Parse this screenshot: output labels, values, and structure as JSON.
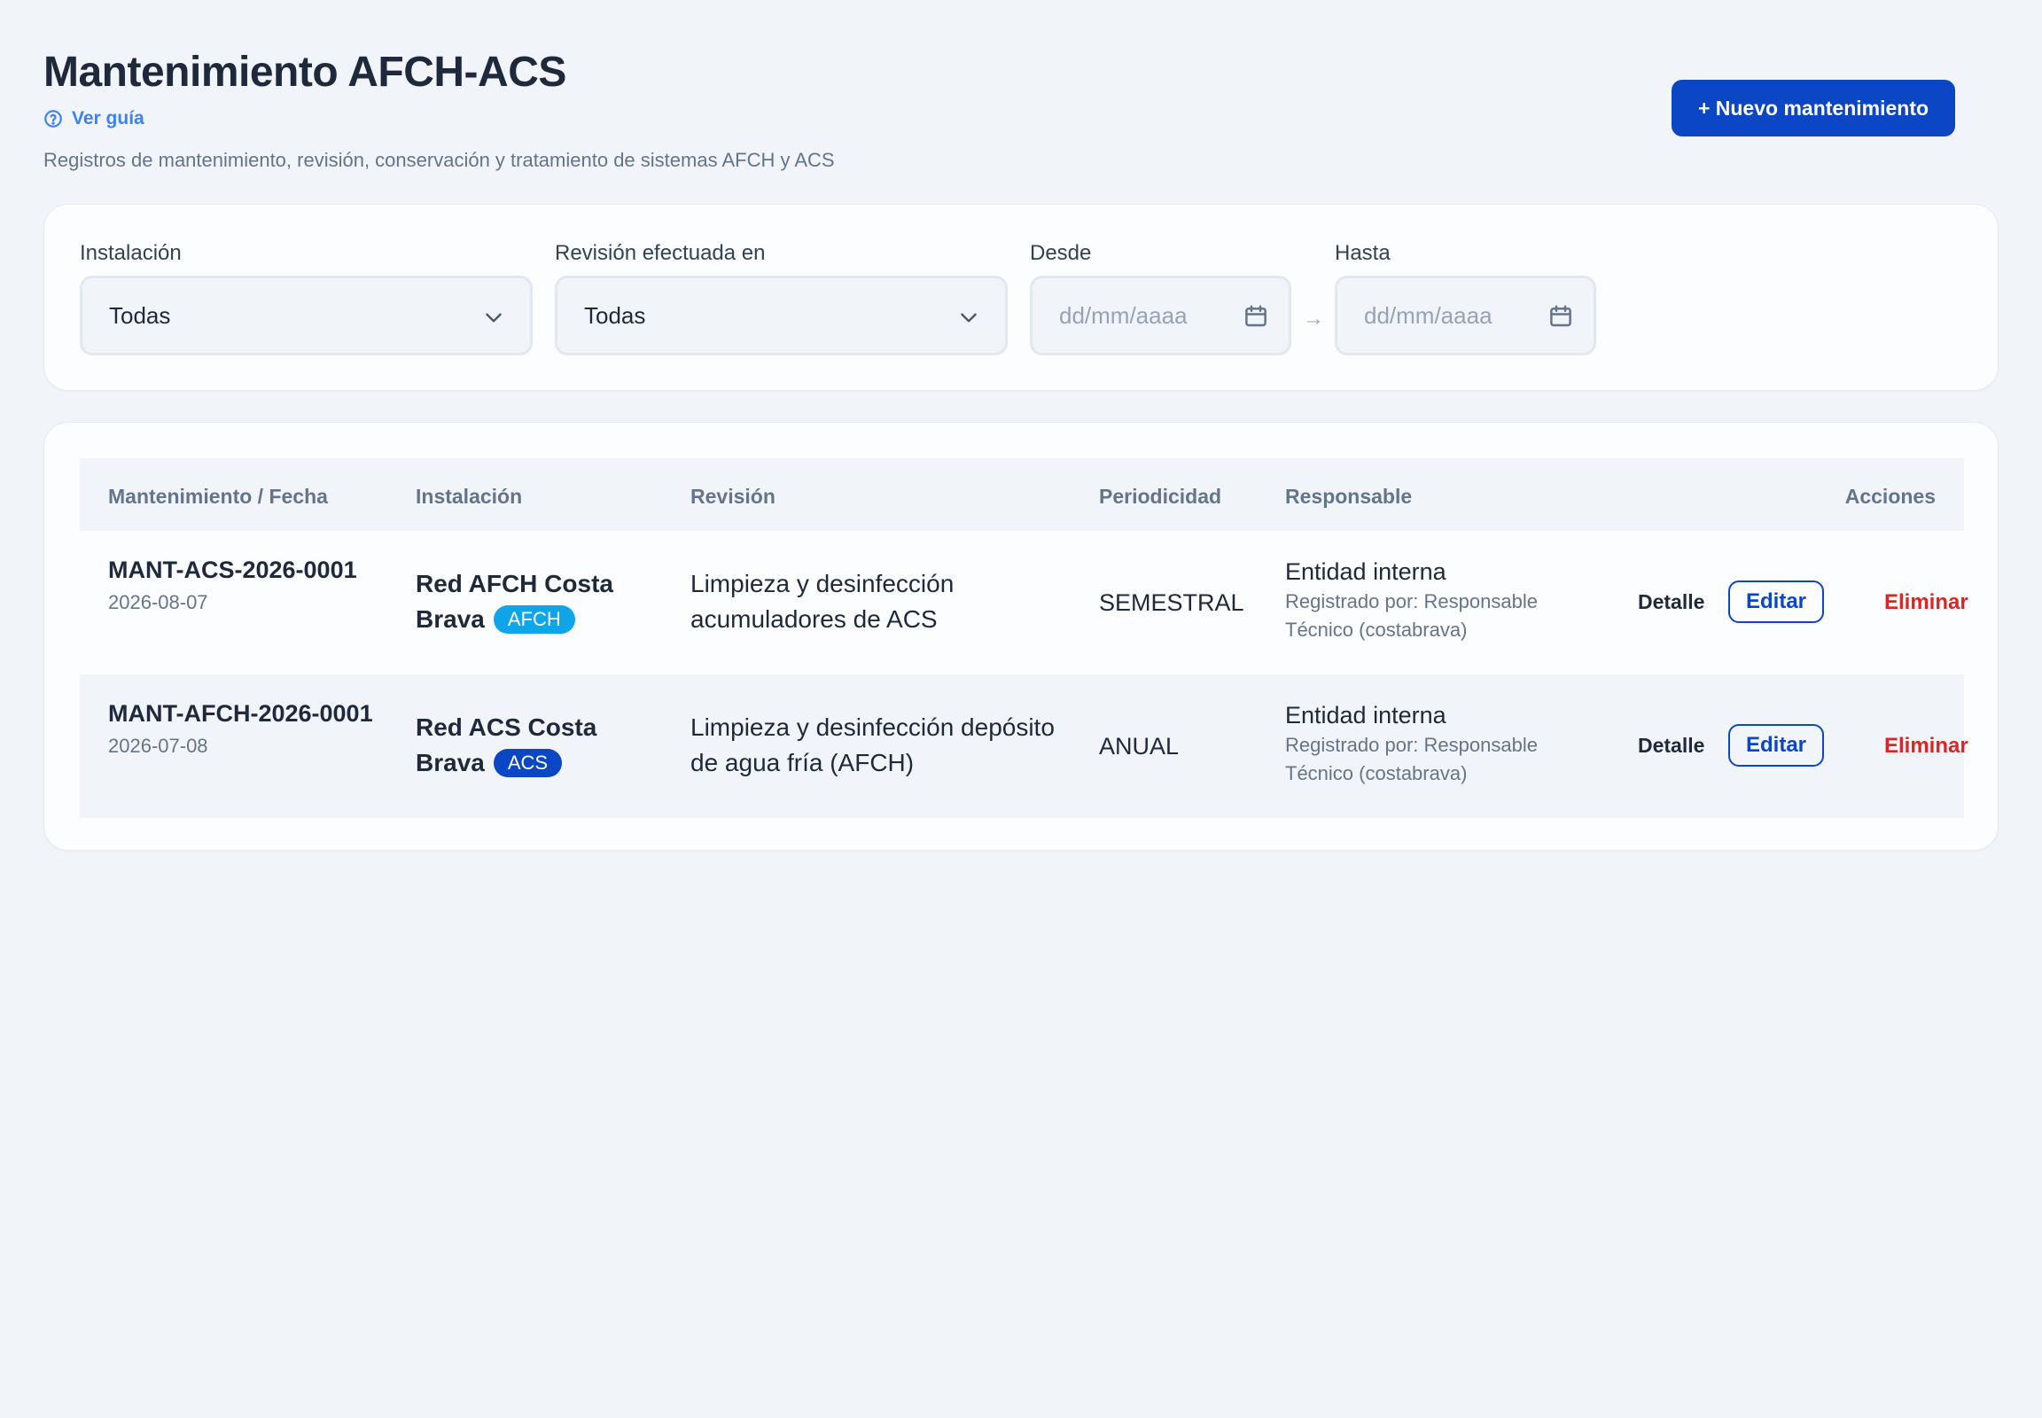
{
  "header": {
    "title": "Mantenimiento AFCH-ACS",
    "guide_label": "Ver guía",
    "subtitle": "Registros de mantenimiento, revisión, conservación y tratamiento de sistemas AFCH y ACS",
    "new_button_label": "+ Nuevo mantenimiento"
  },
  "filters": {
    "installation": {
      "label": "Instalación",
      "value": "Todas"
    },
    "revision_in": {
      "label": "Revisión efectuada en",
      "value": "Todas"
    },
    "from": {
      "label": "Desde",
      "placeholder": "dd/mm/aaaa"
    },
    "to": {
      "label": "Hasta",
      "placeholder": "dd/mm/aaaa"
    },
    "range_arrow": "→"
  },
  "table": {
    "columns": {
      "maintenance": "Mantenimiento / Fecha",
      "installation": "Instalación",
      "revision": "Revisión",
      "periodicity": "Periodicidad",
      "responsible": "Responsable",
      "actions": "Acciones"
    },
    "rows": [
      {
        "code": "MANT-ACS-2026-0001",
        "date": "2026-08-07",
        "installation": "Red AFCH Costa Brava",
        "badge": "AFCH",
        "badge_color": "#0ea5e9",
        "revision": "Limpieza y desinfección acumuladores de ACS",
        "periodicity": "SEMESTRAL",
        "responsible": "Entidad interna",
        "registered_by": "Registrado por: Responsable Técnico (costabrava)"
      },
      {
        "code": "MANT-AFCH-2026-0001",
        "date": "2026-07-08",
        "installation": "Red ACS Costa Brava",
        "badge": "ACS",
        "badge_color": "#0b46c4",
        "revision": "Limpieza y desinfección depósito de agua fría (AFCH)",
        "periodicity": "ANUAL",
        "responsible": "Entidad interna",
        "registered_by": "Registrado por: Responsable Técnico (costabrava)"
      }
    ],
    "actions": {
      "detail": "Detalle",
      "edit": "Editar",
      "delete": "Eliminar"
    }
  },
  "colors": {
    "primary": "#0b46c4",
    "danger": "#dc2626",
    "afch_badge": "#0ea5e9",
    "acs_badge": "#0b46c4"
  }
}
